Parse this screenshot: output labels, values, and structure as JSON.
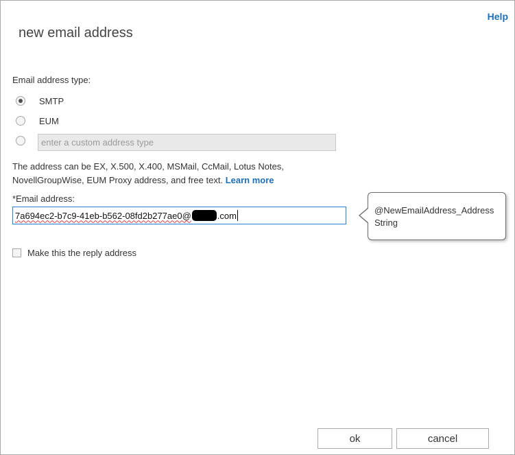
{
  "dialog": {
    "title": "new email address",
    "help_label": "Help"
  },
  "address_type": {
    "label": "Email address type:",
    "options": [
      {
        "label": "SMTP",
        "selected": true
      },
      {
        "label": "EUM",
        "selected": false
      },
      {
        "label": "",
        "selected": false
      }
    ],
    "custom_placeholder": "enter a custom address type"
  },
  "help_text": {
    "body": "The address can be EX, X.500, X.400, MSMail, CcMail, Lotus Notes, NovellGroupWise, EUM Proxy address, and free text.",
    "link": "Learn more"
  },
  "email": {
    "label": "*Email address:",
    "value_prefix": "7a694ec2-b7c9-41eb-b562-08fd2b277ae0@",
    "value_suffix": ".com",
    "tooltip": "@NewEmailAddress_AddressString"
  },
  "reply_checkbox": {
    "label": "Make this the reply address",
    "checked": false
  },
  "buttons": {
    "ok": "ok",
    "cancel": "cancel"
  },
  "colors": {
    "link": "#1e6fb8",
    "input_focus_border": "#2a7fd4",
    "disabled_input_bg": "#e9e9e9"
  }
}
